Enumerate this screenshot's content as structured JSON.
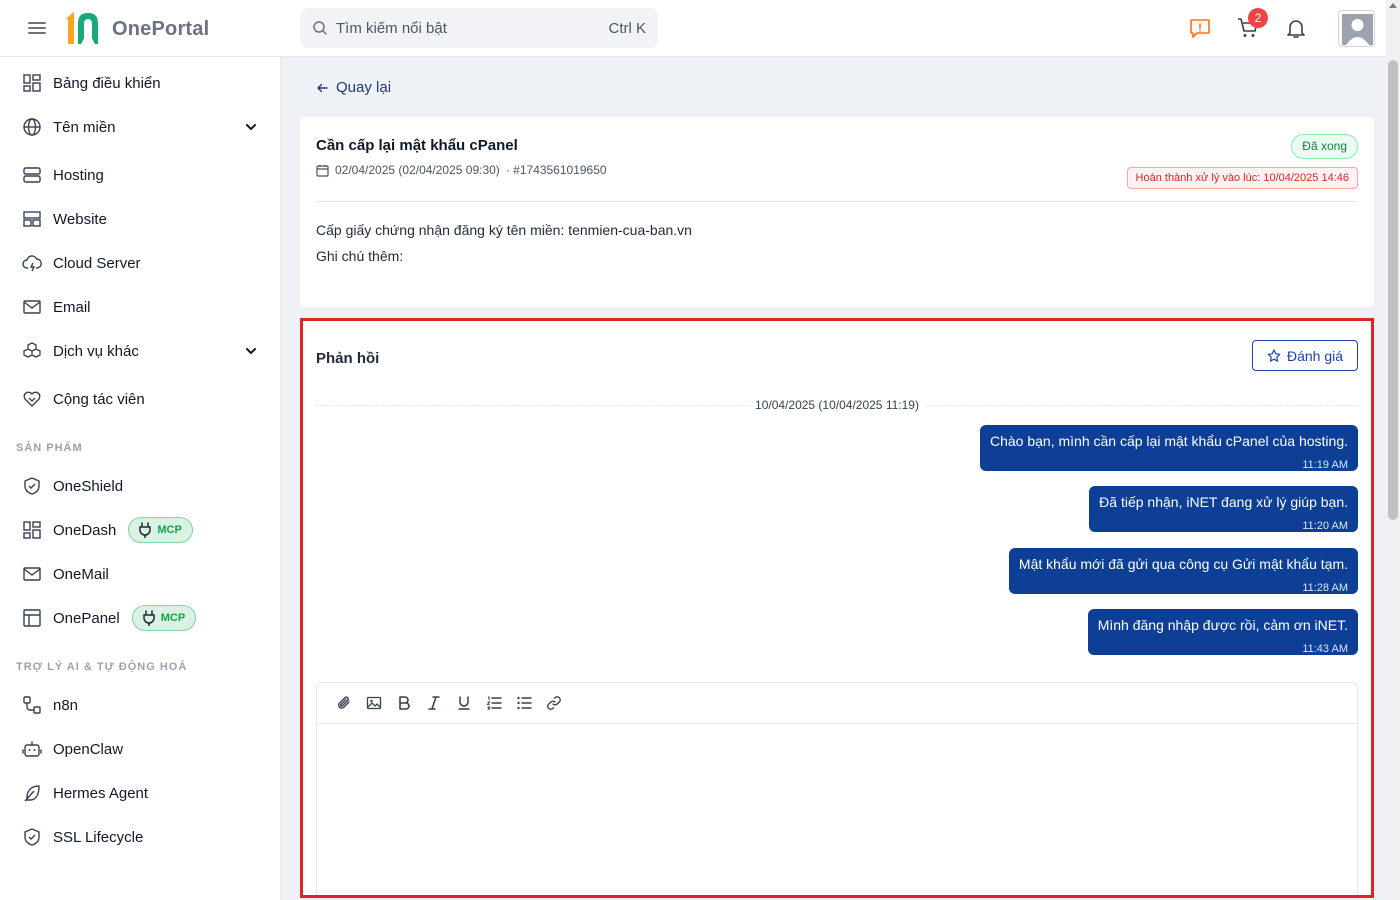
{
  "header": {
    "logo_text": "OnePortal",
    "search_placeholder": "Tìm kiếm nổi bật",
    "search_shortcut": "Ctrl K",
    "cart_count": "2",
    "accent_color": "#0c3f95"
  },
  "sidebar": {
    "items": [
      {
        "label": "Bảng điều khiển",
        "icon": "dashboard-icon"
      },
      {
        "label": "Tên miền",
        "icon": "globe-icon",
        "expandable": true
      },
      {
        "label": "Hosting",
        "icon": "server-icon"
      },
      {
        "label": "Website",
        "icon": "website-layout-icon"
      },
      {
        "label": "Cloud Server",
        "icon": "cloud-lightning-icon"
      },
      {
        "label": "Email",
        "icon": "mail-icon"
      },
      {
        "label": "Dịch vụ khác",
        "icon": "cubes-icon",
        "expandable": true
      },
      {
        "label": "Cộng tác viên",
        "icon": "heart-handshake-icon"
      }
    ],
    "section_products": "SẢN PHẨM",
    "products": [
      {
        "label": "OneShield",
        "icon": "shield-check-icon"
      },
      {
        "label": "OneDash",
        "icon": "dashboard-icon",
        "badge": "MCP"
      },
      {
        "label": "OneMail",
        "icon": "mail-icon"
      },
      {
        "label": "OnePanel",
        "icon": "panel-layout-icon",
        "badge": "MCP"
      }
    ],
    "section_ai": "TRỢ LÝ AI & TỰ ĐỘNG HOÁ",
    "ai": [
      {
        "label": "n8n",
        "icon": "workflow-icon"
      },
      {
        "label": "OpenClaw",
        "icon": "robot-icon"
      },
      {
        "label": "Hermes Agent",
        "icon": "feather-icon"
      },
      {
        "label": "SSL Lifecycle",
        "icon": "shield-check-icon"
      }
    ]
  },
  "main": {
    "back_label": "Quay lại",
    "ticket": {
      "title": "Cần cấp lại mật khẩu cPanel",
      "date": "02/04/2025 (02/04/2025 09:30)",
      "id": "· #1743561019650",
      "status": "Đã xong",
      "done_note": "Hoàn thành xử lý vào lúc: 10/04/2025 14:46",
      "description": "Cấp giấy chứng nhận đăng ký tên miền: tenmien-cua-ban.vn",
      "note_label": "Ghi chú thêm:"
    },
    "reply": {
      "title": "Phản hồi",
      "rate_label": "Đánh giá",
      "date_separator": "10/04/2025 (10/04/2025 11:19)",
      "messages": [
        {
          "text": "Chào bạn, mình cần cấp lại mật khẩu cPanel của hosting.",
          "time": "11:19 AM"
        },
        {
          "text": "Đã tiếp nhận, iNET đang xử lý giúp bạn.",
          "time": "11:20 AM"
        },
        {
          "text": "Mật khẩu mới đã gửi qua công cụ Gửi mật khẩu tạm.",
          "time": "11:28 AM"
        },
        {
          "text": "Mình đăng nhập được rồi, cảm ơn iNET.",
          "time": "11:43 AM"
        }
      ],
      "toolbar": [
        "attach-icon",
        "image-icon",
        "bold-icon",
        "italic-icon",
        "underline-icon",
        "ordered-list-icon",
        "bullet-list-icon",
        "link-icon"
      ]
    }
  }
}
